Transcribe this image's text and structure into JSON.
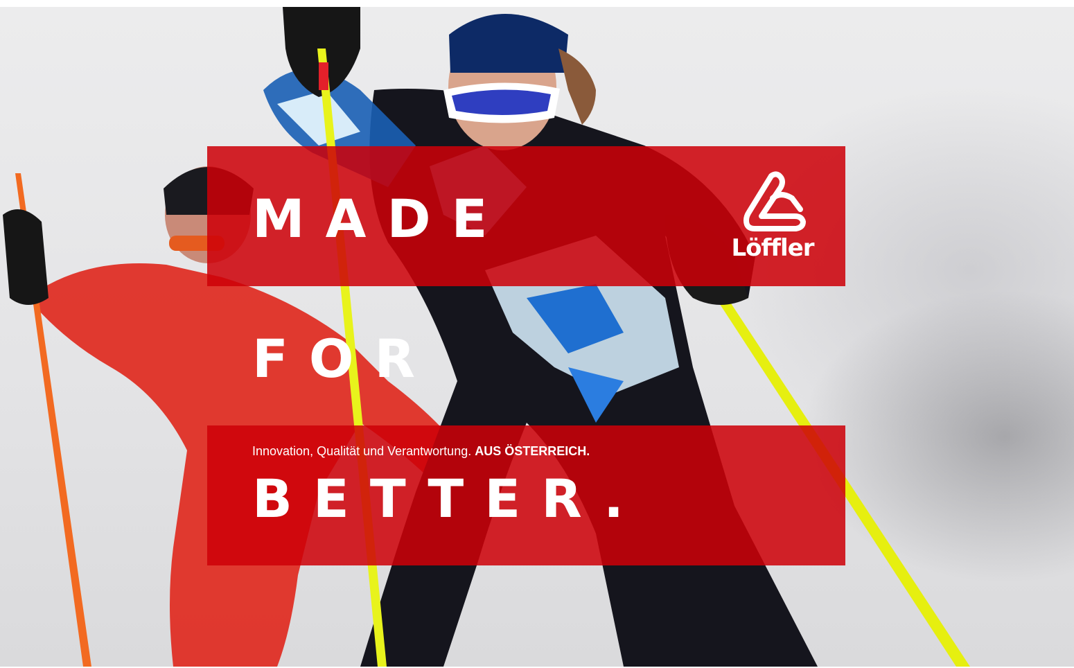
{
  "hero": {
    "headline": [
      "MADE",
      "FOR",
      "BETTER."
    ],
    "tagline": {
      "lead": "Innovation, Qualität und Verantwortung.",
      "emphasis": "AUS ÖSTERREICH."
    },
    "logo": {
      "wordmark": "Löffler",
      "icon": "loeffler-l-icon"
    },
    "colors": {
      "brand_red": "#cd0008",
      "text": "#ffffff"
    }
  }
}
